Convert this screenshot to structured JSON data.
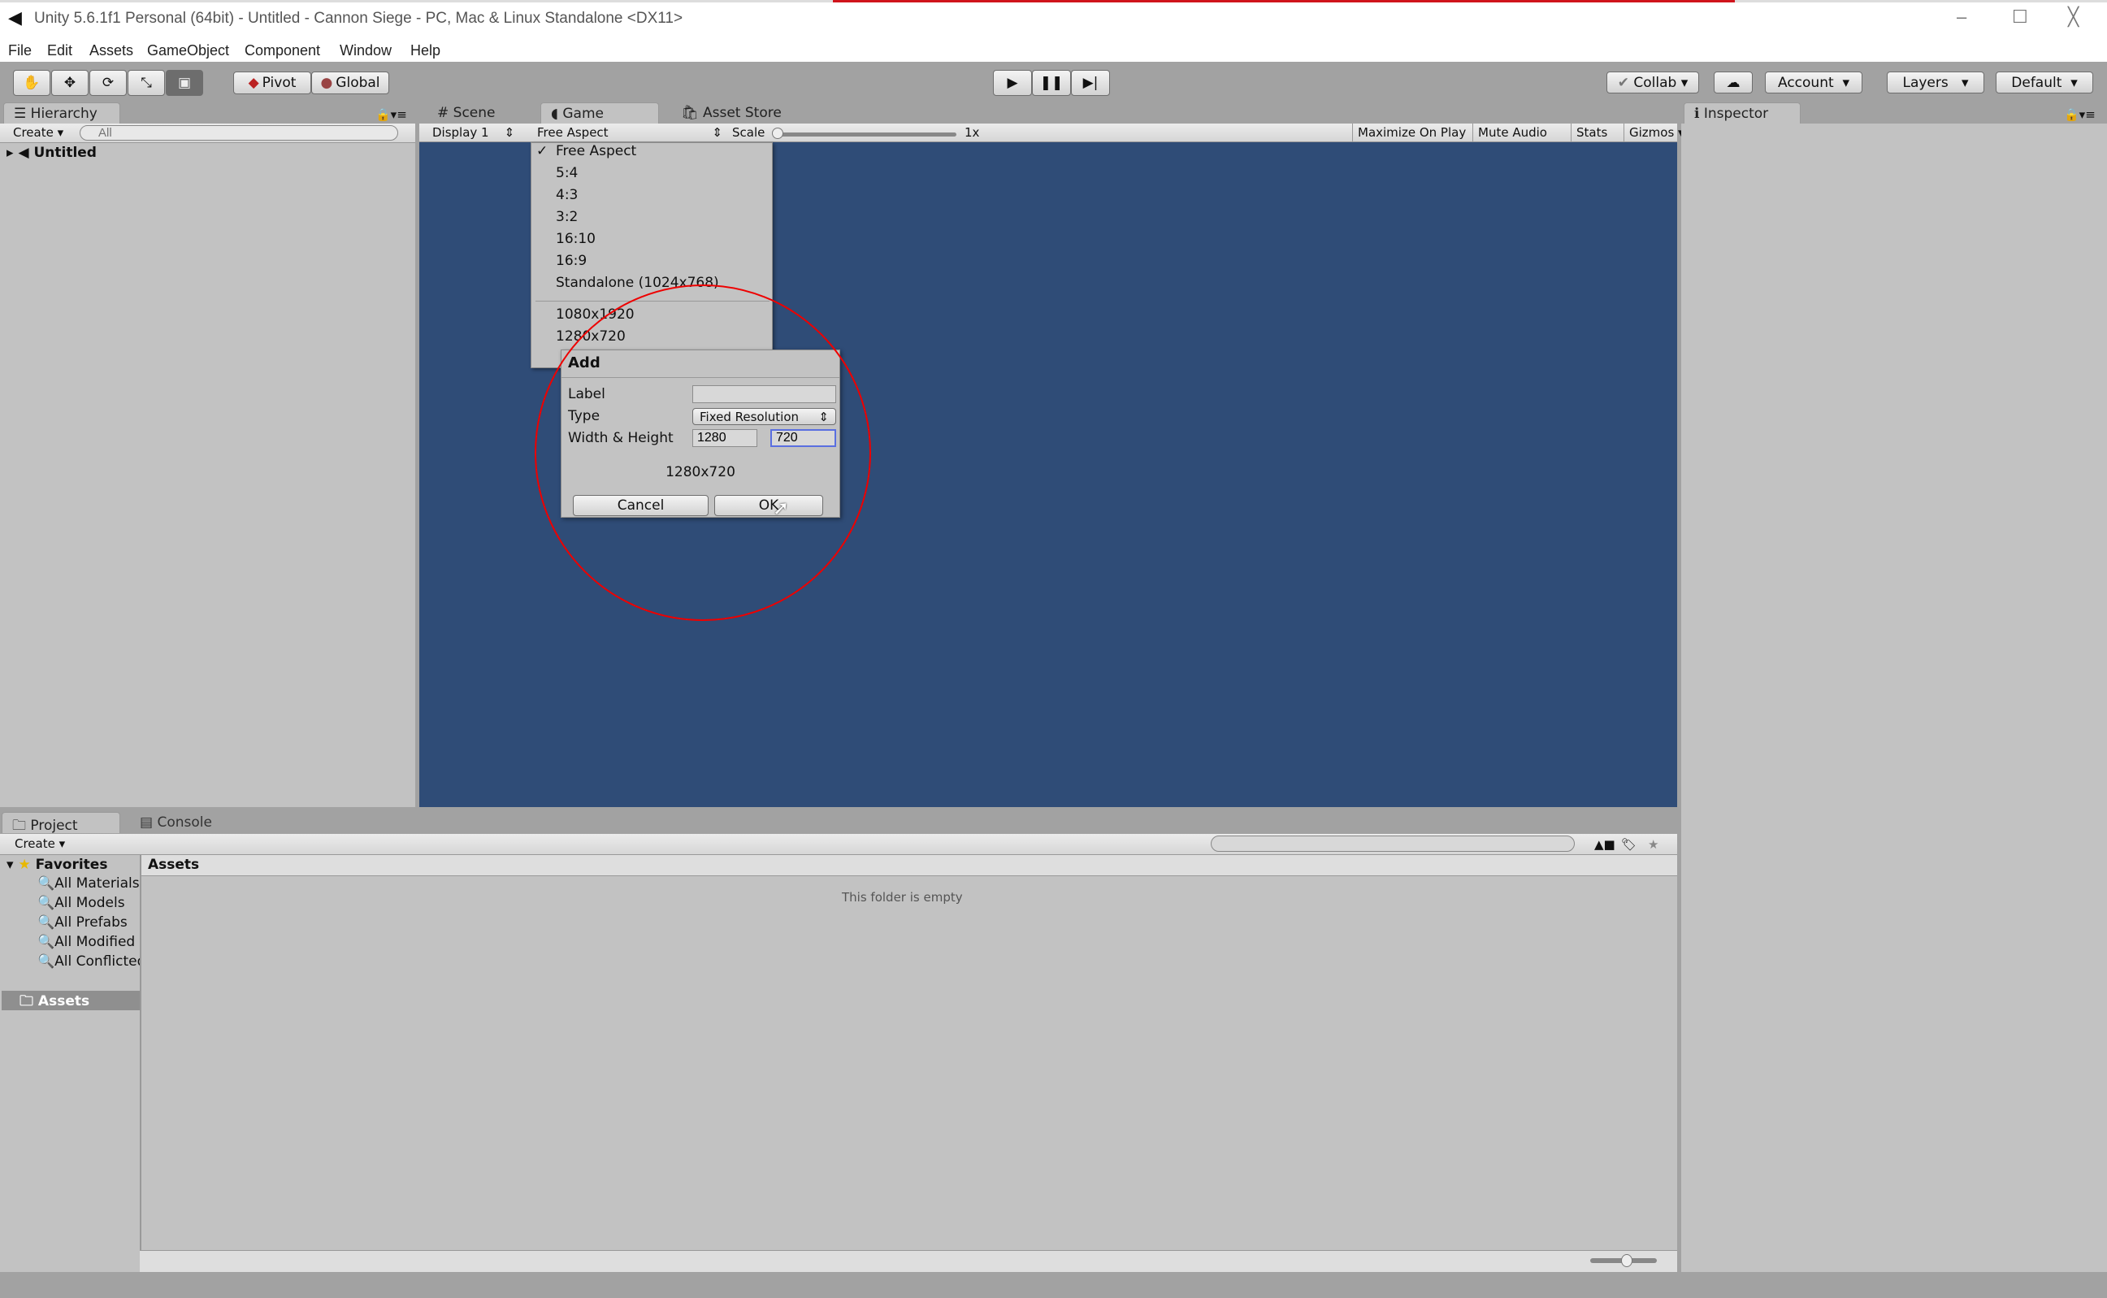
{
  "window": {
    "title": "Unity 5.6.1f1 Personal (64bit) - Untitled - Cannon Siege - PC, Mac & Linux Standalone <DX11>",
    "controls": [
      "–",
      "☐",
      "╳"
    ]
  },
  "menu": [
    "File",
    "Edit",
    "Assets",
    "GameObject",
    "Component",
    "Window",
    "Help"
  ],
  "toolbar": {
    "tools": [
      "hand-icon",
      "move-icon",
      "rotate-icon",
      "scale-icon",
      "rect-icon"
    ],
    "pivot": "Pivot",
    "global": "Global",
    "collab": "Collab",
    "account": "Account",
    "layers": "Layers",
    "layout": "Default"
  },
  "hierarchy": {
    "tab": "Hierarchy",
    "create": "Create",
    "search_placeholder": "All",
    "scene": "Untitled"
  },
  "center_tabs": [
    "Scene",
    "Game",
    "Asset Store"
  ],
  "game_toolbar": {
    "display": "Display 1",
    "aspect": "Free Aspect",
    "scale_label": "Scale",
    "scale_value": "1x",
    "maximize": "Maximize On Play",
    "mute": "Mute Audio",
    "stats": "Stats",
    "gizmos": "Gizmos"
  },
  "aspect_menu": {
    "checked": "Free Aspect",
    "items": [
      "Free Aspect",
      "5:4",
      "4:3",
      "3:2",
      "16:10",
      "16:9",
      "Standalone (1024x768)"
    ],
    "custom": [
      "1080x1920",
      "1280x720"
    ]
  },
  "add_dialog": {
    "title": "Add",
    "label_label": "Label",
    "label_value": "",
    "type_label": "Type",
    "type_value": "Fixed Resolution",
    "wh_label": "Width & Height",
    "width": "1280",
    "height": "720",
    "preview": "1280x720",
    "cancel": "Cancel",
    "ok": "OK"
  },
  "inspector": {
    "tab": "Inspector"
  },
  "project": {
    "tabs": [
      "Project",
      "Console"
    ],
    "create": "Create",
    "favorites": "Favorites",
    "favorite_items": [
      "All Materials",
      "All Models",
      "All Prefabs",
      "All Modified",
      "All Conflicted"
    ],
    "assets_root": "Assets",
    "breadcrumb": "Assets",
    "empty": "This folder is empty"
  },
  "colors": {
    "game_bg": "#2f4c77",
    "annotation": "#e00000"
  }
}
